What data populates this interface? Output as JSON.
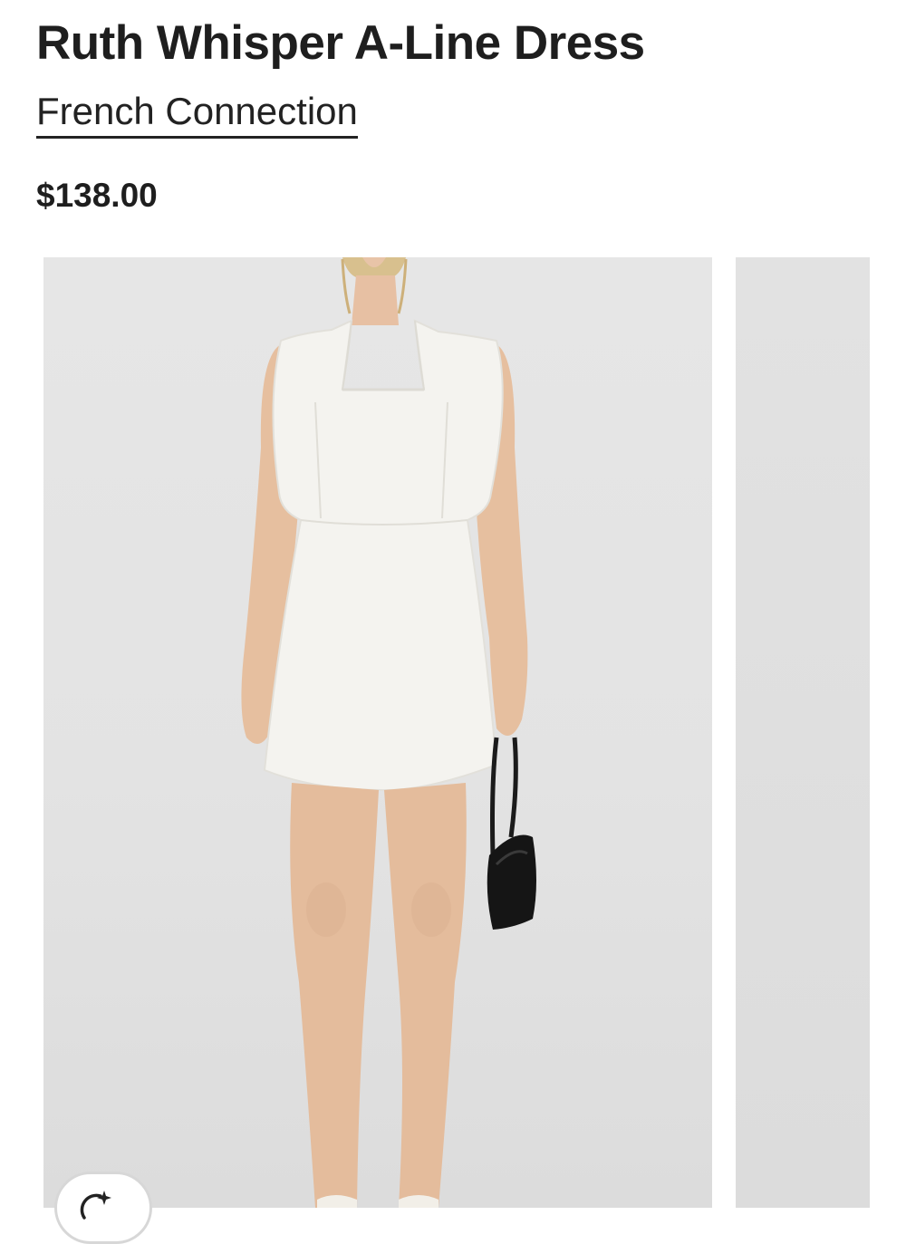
{
  "product": {
    "title": "Ruth Whisper A-Line Dress",
    "brand": "French Connection",
    "price": "$138.00"
  },
  "gallery": {
    "main_image": "model-white-dress-photo",
    "next_image": "next-product-photo-partial"
  },
  "icons": {
    "ai_button_icon": "sparkle-refresh-icon"
  },
  "colors": {
    "text": "#1e1e1e",
    "image_bg": "#e4e4e4",
    "dress": "#f5f4f0"
  }
}
